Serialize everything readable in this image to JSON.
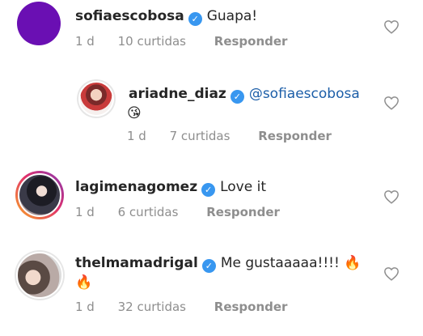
{
  "comments": [
    {
      "username": "sofiaescobosa",
      "verified": true,
      "mention": "",
      "text": "Guapa!",
      "text_line2": "",
      "time": "1 d",
      "likes": "10 curtidas",
      "reply_label": "Responder",
      "avatar_color": "#6a0fb3"
    },
    {
      "username": "ariadne_diaz",
      "verified": true,
      "mention": "@sofiaescobosa",
      "text": "",
      "text_line2": "😘",
      "time": "1 d",
      "likes": "7 curtidas",
      "reply_label": "Responder"
    },
    {
      "username": "lagimenagomez",
      "verified": true,
      "mention": "",
      "text": "Love it",
      "text_line2": "",
      "time": "1 d",
      "likes": "6 curtidas",
      "reply_label": "Responder"
    },
    {
      "username": "thelmamadrigal",
      "verified": true,
      "mention": "",
      "text": "Me gustaaaaa!!!! 🔥",
      "text_line2": "🔥",
      "time": "1 d",
      "likes": "32 curtidas",
      "reply_label": "Responder"
    }
  ],
  "icons": {
    "verified": "verified-badge-icon",
    "like": "heart-outline-icon"
  },
  "colors": {
    "verified_blue": "#3897f0",
    "mention_blue": "#1c5ea8",
    "meta_gray": "#8e8e8e"
  }
}
